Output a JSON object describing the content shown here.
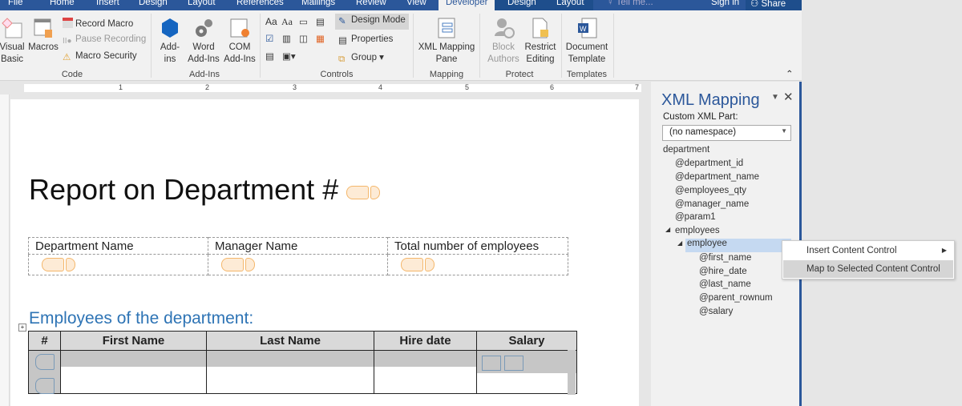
{
  "tabs": [
    "File",
    "Home",
    "Insert",
    "Design",
    "Layout",
    "References",
    "Mailings",
    "Review",
    "View",
    "Developer",
    "Design",
    "Layout"
  ],
  "active_tab": "Developer",
  "tell_me": "Tell me...",
  "sign_in": "Sign in",
  "share": "Share",
  "ribbon": {
    "code": {
      "label": "Code",
      "visual_basic": "Visual Basic",
      "macros": "Macros",
      "record": "Record Macro",
      "pause": "Pause Recording",
      "security": "Macro Security"
    },
    "addins": {
      "label": "Add-Ins",
      "addins": "Add-ins",
      "word": "Word Add-Ins",
      "com": "COM Add-Ins"
    },
    "controls": {
      "label": "Controls",
      "design_mode": "Design Mode",
      "properties": "Properties",
      "group": "Group",
      "aa1": "Aa",
      "aa2": "Aa"
    },
    "mapping": {
      "label": "Mapping",
      "pane": "XML Mapping Pane"
    },
    "protect": {
      "label": "Protect",
      "block": "Block Authors",
      "restrict": "Restrict Editing"
    },
    "templates": {
      "label": "Templates",
      "doc": "Document Template"
    }
  },
  "ruler": [
    "1",
    "2",
    "3",
    "4",
    "5",
    "6",
    "7"
  ],
  "document": {
    "title": "Report on Department #",
    "info_headers": [
      "Department Name",
      "Manager Name",
      "Total number of employees"
    ],
    "section": "Employees of the department:",
    "emp_headers": [
      "#",
      "First Name",
      "Last Name",
      "Hire date",
      "Salary"
    ]
  },
  "pane": {
    "title": "XML Mapping",
    "part_label": "Custom XML Part:",
    "part_value": "(no namespace)",
    "tree": [
      "department",
      "@department_id",
      "@department_name",
      "@employees_qty",
      "@manager_name",
      "@param1",
      "employees",
      "employee",
      "@first_name",
      "@hire_date",
      "@last_name",
      "@parent_rownum",
      "@salary"
    ],
    "selected": "employee"
  },
  "context_menu": [
    "Insert Content Control",
    "Map to Selected Content Control"
  ],
  "colors": {
    "brand": "#2b579a",
    "heading": "#2e74b5",
    "selection": "#c5d9f1",
    "cc_border": "#f4b76b"
  }
}
